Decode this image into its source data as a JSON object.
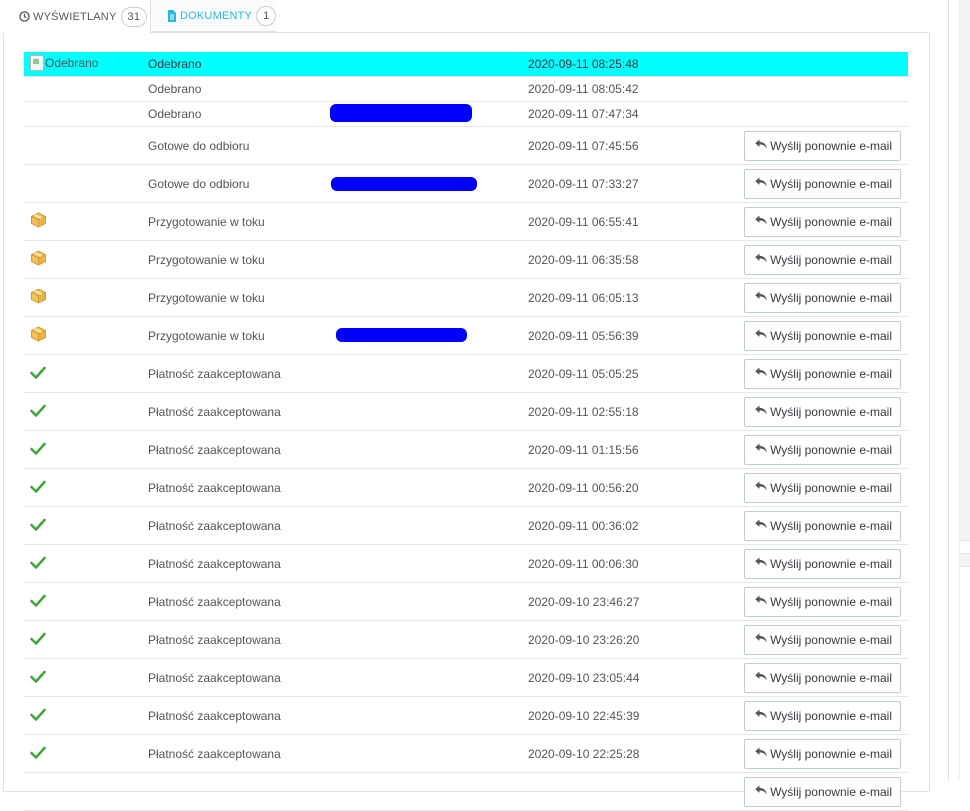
{
  "tabs": [
    {
      "label": "WYŚWIETLANY",
      "count": "31",
      "icon": "clock-icon",
      "active": true
    },
    {
      "label": "DOKUMENTY",
      "count": "1",
      "icon": "document-icon",
      "active": false
    }
  ],
  "colors": {
    "accent": "#25b9d7",
    "highlight": "#00ffff",
    "check": "#3fa63a",
    "redaction": "#0000ff"
  },
  "history": {
    "resend_label": "Wyślij ponownie e-mail",
    "rows": [
      {
        "icon": "broken-image",
        "icon_alt": "Odebrano",
        "state": "Odebrano",
        "date": "2020-09-11 08:25:48",
        "resend": false,
        "highlight": true
      },
      {
        "icon": "",
        "state": "Odebrano",
        "date": "2020-09-11 08:05:42",
        "resend": false
      },
      {
        "icon": "",
        "state": "Odebrano",
        "date": "2020-09-11 07:47:34",
        "resend": false
      },
      {
        "icon": "",
        "state": "Gotowe do odbioru",
        "date": "2020-09-11 07:45:56",
        "resend": true
      },
      {
        "icon": "",
        "state": "Gotowe do odbioru",
        "date": "2020-09-11 07:33:27",
        "resend": true
      },
      {
        "icon": "package-icon",
        "state": "Przygotowanie w toku",
        "date": "2020-09-11 06:55:41",
        "resend": true
      },
      {
        "icon": "package-icon",
        "state": "Przygotowanie w toku",
        "date": "2020-09-11 06:35:58",
        "resend": true
      },
      {
        "icon": "package-icon",
        "state": "Przygotowanie w toku",
        "date": "2020-09-11 06:05:13",
        "resend": true
      },
      {
        "icon": "package-icon",
        "state": "Przygotowanie w toku",
        "date": "2020-09-11 05:56:39",
        "resend": true
      },
      {
        "icon": "check-icon",
        "state": "Płatność zaakceptowana",
        "date": "2020-09-11 05:05:25",
        "resend": true
      },
      {
        "icon": "check-icon",
        "state": "Płatność zaakceptowana",
        "date": "2020-09-11 02:55:18",
        "resend": true
      },
      {
        "icon": "check-icon",
        "state": "Płatność zaakceptowana",
        "date": "2020-09-11 01:15:56",
        "resend": true
      },
      {
        "icon": "check-icon",
        "state": "Płatność zaakceptowana",
        "date": "2020-09-11 00:56:20",
        "resend": true
      },
      {
        "icon": "check-icon",
        "state": "Płatność zaakceptowana",
        "date": "2020-09-11 00:36:02",
        "resend": true
      },
      {
        "icon": "check-icon",
        "state": "Płatność zaakceptowana",
        "date": "2020-09-11 00:06:30",
        "resend": true
      },
      {
        "icon": "check-icon",
        "state": "Płatność zaakceptowana",
        "date": "2020-09-10 23:46:27",
        "resend": true
      },
      {
        "icon": "check-icon",
        "state": "Płatność zaakceptowana",
        "date": "2020-09-10 23:26:20",
        "resend": true
      },
      {
        "icon": "check-icon",
        "state": "Płatność zaakceptowana",
        "date": "2020-09-10 23:05:44",
        "resend": true
      },
      {
        "icon": "check-icon",
        "state": "Płatność zaakceptowana",
        "date": "2020-09-10 22:45:39",
        "resend": true
      },
      {
        "icon": "check-icon",
        "state": "Płatność zaakceptowana",
        "date": "2020-09-10 22:25:28",
        "resend": true
      },
      {
        "icon": "",
        "state": "",
        "date": "",
        "resend": true
      }
    ]
  }
}
